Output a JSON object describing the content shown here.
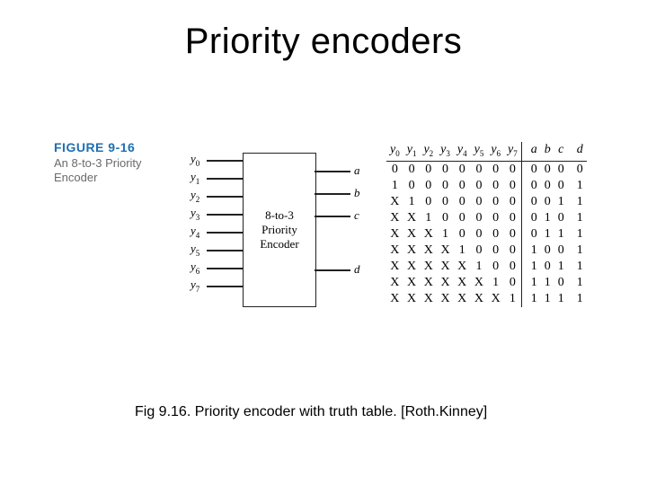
{
  "title": "Priority encoders",
  "figure": {
    "number": "FIGURE 9-16",
    "description": "An 8-to-3 Priority Encoder"
  },
  "block": {
    "line1": "8-to-3",
    "line2": "Priority",
    "line3": "Encoder"
  },
  "inputs": [
    "y0",
    "y1",
    "y2",
    "y3",
    "y4",
    "y5",
    "y6",
    "y7"
  ],
  "outputs": [
    "a",
    "b",
    "c",
    "d"
  ],
  "truth_table": {
    "input_headers": [
      "y0",
      "y1",
      "y2",
      "y3",
      "y4",
      "y5",
      "y6",
      "y7"
    ],
    "output_headers": [
      "a",
      "b",
      "c",
      "d"
    ],
    "rows": [
      {
        "in": [
          "0",
          "0",
          "0",
          "0",
          "0",
          "0",
          "0",
          "0"
        ],
        "out": [
          "0",
          "0",
          "0",
          "0"
        ]
      },
      {
        "in": [
          "1",
          "0",
          "0",
          "0",
          "0",
          "0",
          "0",
          "0"
        ],
        "out": [
          "0",
          "0",
          "0",
          "1"
        ]
      },
      {
        "in": [
          "X",
          "1",
          "0",
          "0",
          "0",
          "0",
          "0",
          "0"
        ],
        "out": [
          "0",
          "0",
          "1",
          "1"
        ]
      },
      {
        "in": [
          "X",
          "X",
          "1",
          "0",
          "0",
          "0",
          "0",
          "0"
        ],
        "out": [
          "0",
          "1",
          "0",
          "1"
        ]
      },
      {
        "in": [
          "X",
          "X",
          "X",
          "1",
          "0",
          "0",
          "0",
          "0"
        ],
        "out": [
          "0",
          "1",
          "1",
          "1"
        ]
      },
      {
        "in": [
          "X",
          "X",
          "X",
          "X",
          "1",
          "0",
          "0",
          "0"
        ],
        "out": [
          "1",
          "0",
          "0",
          "1"
        ]
      },
      {
        "in": [
          "X",
          "X",
          "X",
          "X",
          "X",
          "1",
          "0",
          "0"
        ],
        "out": [
          "1",
          "0",
          "1",
          "1"
        ]
      },
      {
        "in": [
          "X",
          "X",
          "X",
          "X",
          "X",
          "X",
          "1",
          "0"
        ],
        "out": [
          "1",
          "1",
          "0",
          "1"
        ]
      },
      {
        "in": [
          "X",
          "X",
          "X",
          "X",
          "X",
          "X",
          "X",
          "1"
        ],
        "out": [
          "1",
          "1",
          "1",
          "1"
        ]
      }
    ]
  },
  "caption": "Fig 9.16. Priority encoder with truth table. [Roth.Kinney]"
}
